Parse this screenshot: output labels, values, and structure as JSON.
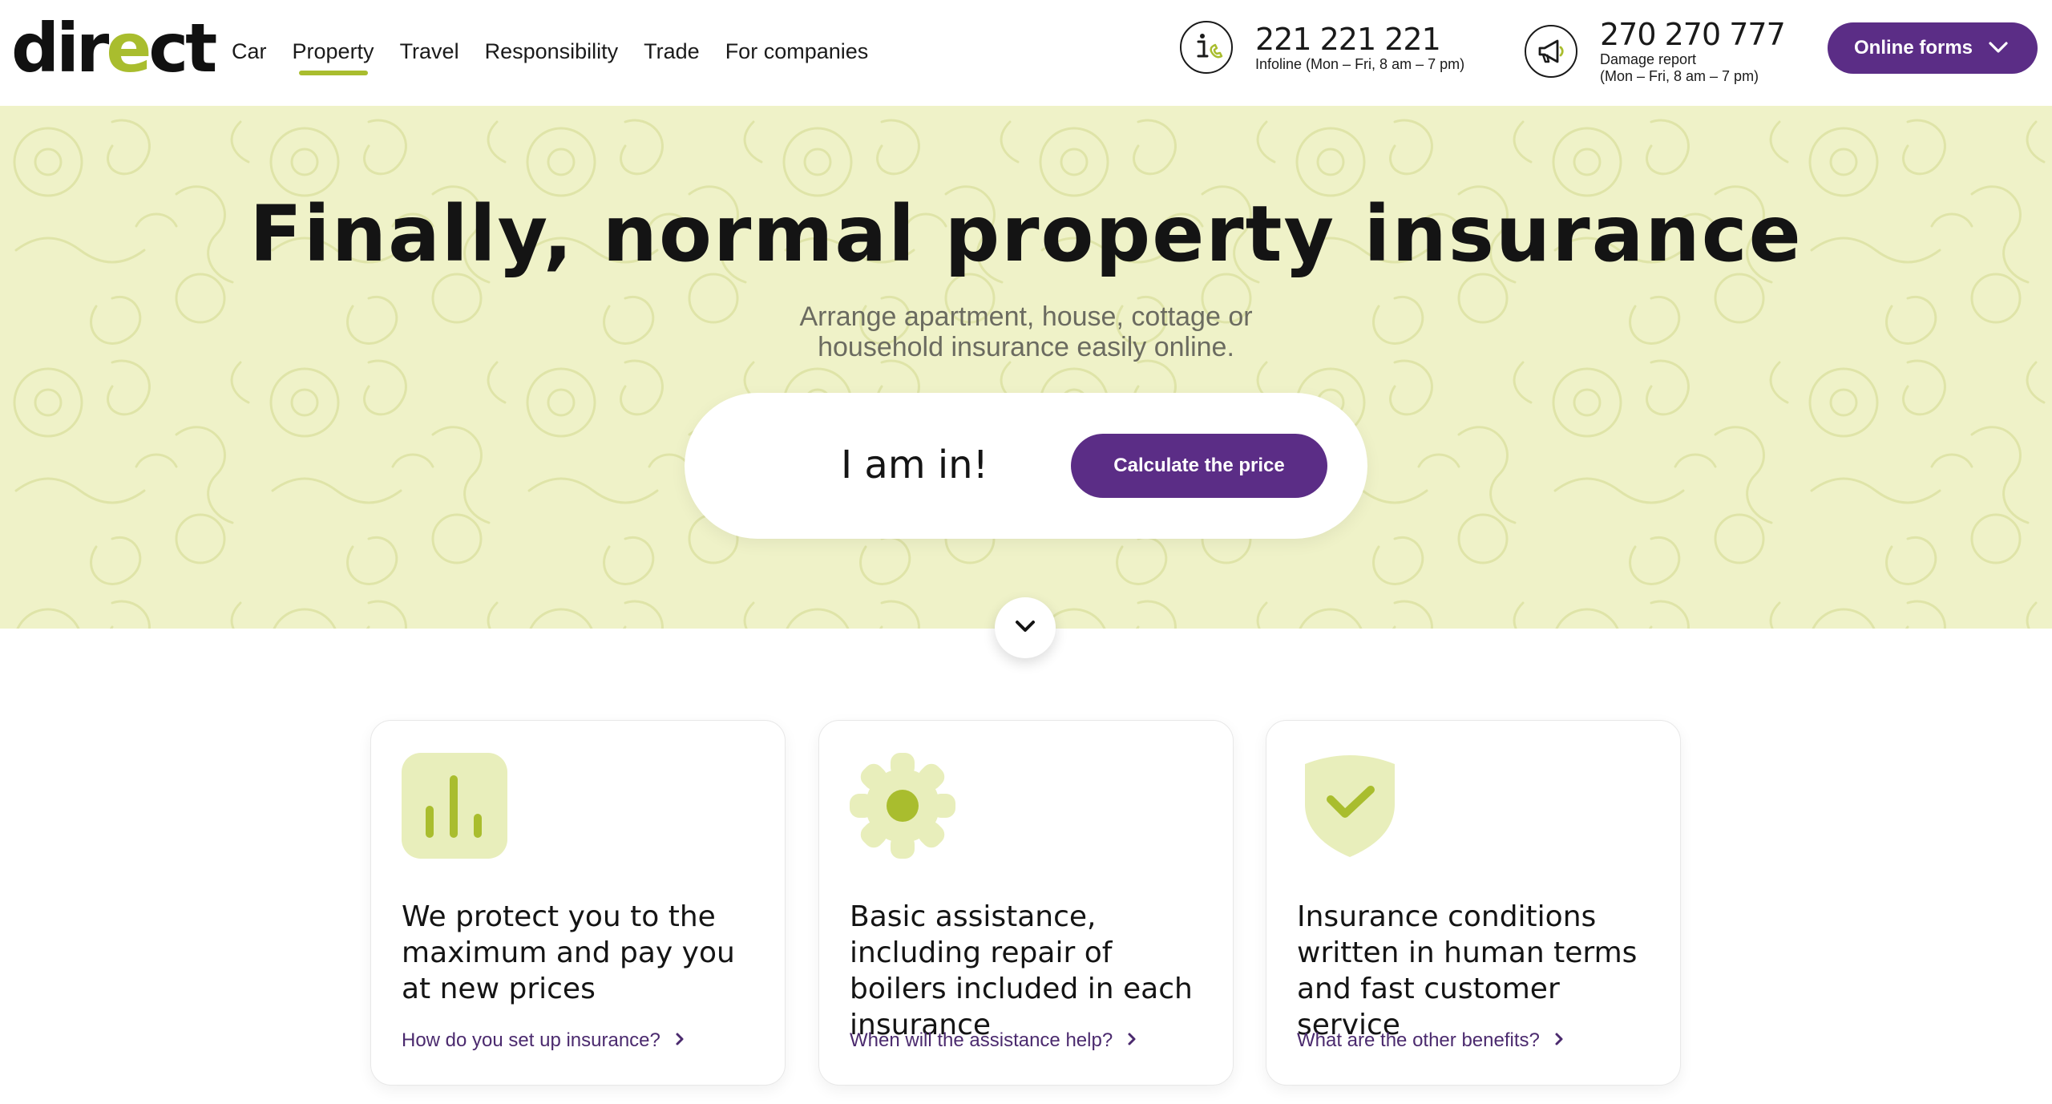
{
  "brand": {
    "logo_prefix": "dir",
    "logo_accent": "e",
    "logo_suffix": "ct",
    "accent_color": "#a9bd2e",
    "primary_color": "#5b2d86"
  },
  "nav": {
    "items": [
      {
        "label": "Car"
      },
      {
        "label": "Property",
        "active": true
      },
      {
        "label": "Travel"
      },
      {
        "label": "Responsibility"
      },
      {
        "label": "Trade"
      },
      {
        "label": "For companies"
      }
    ]
  },
  "contacts": {
    "infoline": {
      "icon": "info-phone-icon",
      "number": "221 221 221",
      "hours": "Infoline (Mon – Fri, 8 am – 7 pm)"
    },
    "damage": {
      "icon": "megaphone-icon",
      "number": "270 270 777",
      "label": "Damage report",
      "hours": "(Mon – Fri, 8 am – 7 pm)"
    }
  },
  "online_forms": {
    "label": "Online forms",
    "icon": "chevron-down-icon"
  },
  "hero": {
    "title": "Finally, normal property insurance",
    "subtitle_line1": "Arrange apartment, house, cottage or",
    "subtitle_line2": "household insurance easily online.",
    "cta_text": "I am in!",
    "cta_button": "Calculate the price",
    "scroll_icon": "chevron-down-icon"
  },
  "cards": [
    {
      "icon": "bar-chart-icon",
      "title": "We protect you to the maximum and pay you at new prices",
      "link": "How do you set up insurance?"
    },
    {
      "icon": "gear-icon",
      "title": "Basic assistance, including repair of boilers included in each insurance",
      "link": "When will the assistance help?"
    },
    {
      "icon": "shield-check-icon",
      "title": "Insurance conditions written in human terms and fast customer service",
      "link": "What are the other benefits?"
    }
  ]
}
